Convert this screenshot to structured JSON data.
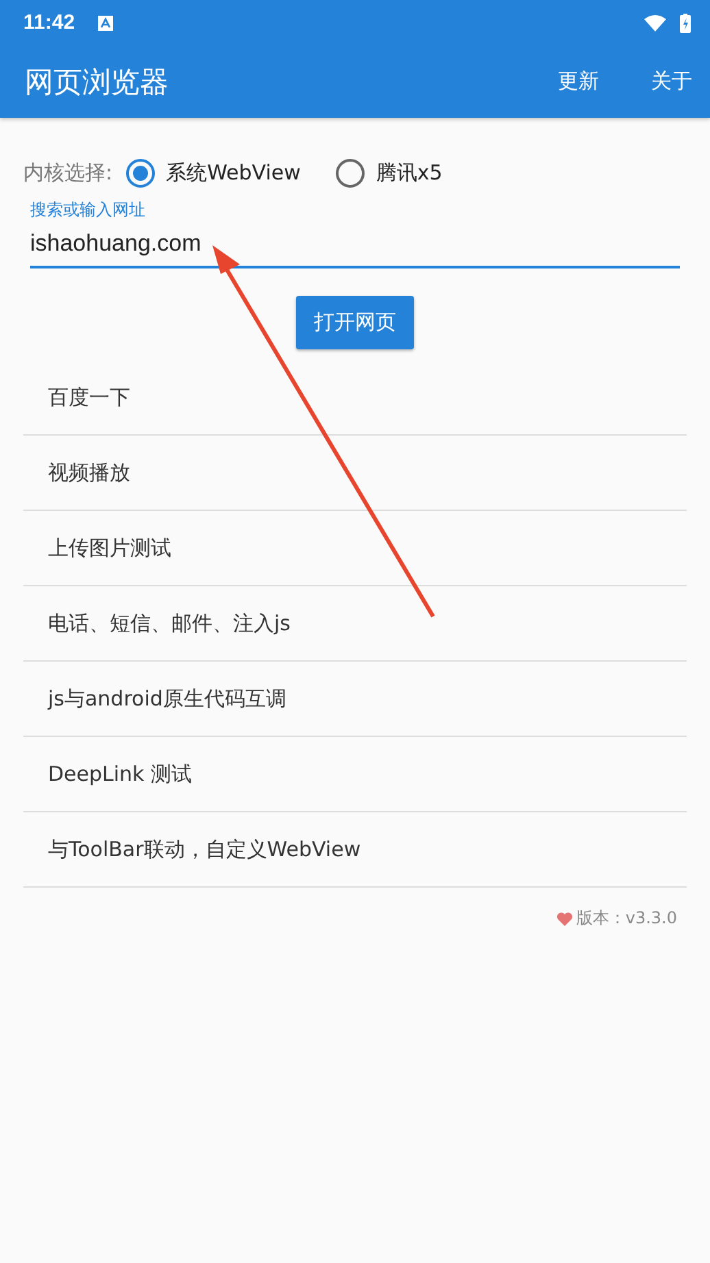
{
  "status_bar": {
    "time": "11:42"
  },
  "app_bar": {
    "title": "网页浏览器",
    "actions": [
      "更新",
      "关于"
    ]
  },
  "kernel": {
    "label": "内核选择:",
    "options": [
      {
        "label": "系统WebView",
        "selected": true
      },
      {
        "label": "腾讯x5",
        "selected": false
      }
    ]
  },
  "url_field": {
    "label": "搜索或输入网址",
    "value": "ishaohuang.com"
  },
  "open_button": "打开网页",
  "menu_items": [
    "百度一下",
    "视频播放",
    "上传图片测试",
    "电话、短信、邮件、注入js",
    "js与android原生代码互调",
    "DeepLink 测试",
    "与ToolBar联动，自定义WebView"
  ],
  "version": "版本：v3.3.0"
}
